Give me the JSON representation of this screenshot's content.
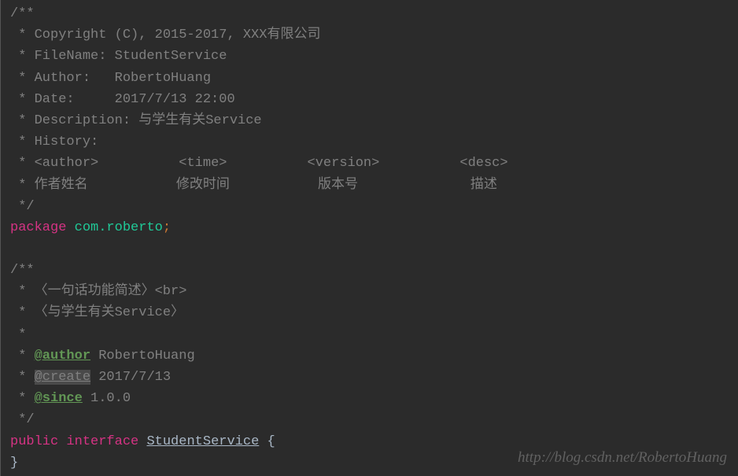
{
  "code": {
    "l1": "/**",
    "l2": " * Copyright (C), 2015-2017, XXX有限公司",
    "l3": " * FileName: StudentService",
    "l4": " * Author:   RobertoHuang",
    "l5": " * Date:     2017/7/13 22:00",
    "l6": " * Description: 与学生有关Service",
    "l7": " * History:",
    "l8_prefix": " * ",
    "l8_author": "<author>",
    "l8_sp1": "          ",
    "l8_time": "<time>",
    "l8_sp2": "          ",
    "l8_version": "<version>",
    "l8_sp3": "          ",
    "l8_desc": "<desc>",
    "l9": " * 作者姓名           修改时间           版本号              描述",
    "l10": " */",
    "l11_kw": "package",
    "l11_sp": " ",
    "l11_id": "com.roberto",
    "l11_semi": ";",
    "l12": "",
    "l13": "/**",
    "l14_prefix": " * 〈一句话功能简述〉",
    "l14_br": "<br>",
    "l15": " * 〈与学生有关Service〉",
    "l16": " *",
    "l17_prefix": " * ",
    "l17_tag": "@author",
    "l17_val": " RobertoHuang",
    "l18_prefix": " * ",
    "l18_tag": "@create",
    "l18_val": " 2017/7/13",
    "l19_prefix": " * ",
    "l19_tag": "@since",
    "l19_val": " 1.0.0",
    "l20": " */",
    "l21_public": "public",
    "l21_sp1": " ",
    "l21_interface": "interface",
    "l21_sp2": " ",
    "l21_name": "StudentService",
    "l21_brace": " {",
    "l22": "}"
  },
  "watermark": "http://blog.csdn.net/RobertoHuang"
}
